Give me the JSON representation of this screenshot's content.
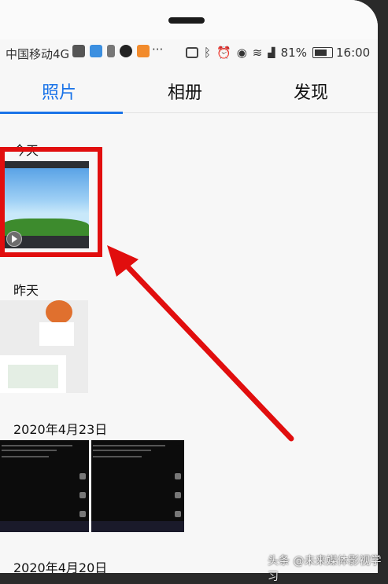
{
  "status_bar": {
    "carrier": "中国移动4G",
    "more": "···",
    "battery": "81%",
    "time": "16:00",
    "icons": [
      "mountain-icon",
      "shield-icon",
      "usb-icon",
      "tiktok-icon",
      "video-app-icon",
      "cast-icon",
      "bluetooth-icon",
      "alarm-icon",
      "eye-icon",
      "wifi-icon",
      "signal-icon",
      "battery-icon"
    ]
  },
  "tabs": [
    {
      "label": "照片",
      "active": true
    },
    {
      "label": "相册",
      "active": false
    },
    {
      "label": "发现",
      "active": false
    }
  ],
  "sections": [
    {
      "label": "今天"
    },
    {
      "label": "昨天"
    },
    {
      "label": "2020年4月23日"
    },
    {
      "label": "2020年4月20日"
    }
  ],
  "annotation": {
    "color": "#e10e0e"
  },
  "watermark": "头条 @未来媒体影视学习",
  "colors": {
    "accent": "#1a73e8",
    "annotation_red": "#e10e0e"
  }
}
